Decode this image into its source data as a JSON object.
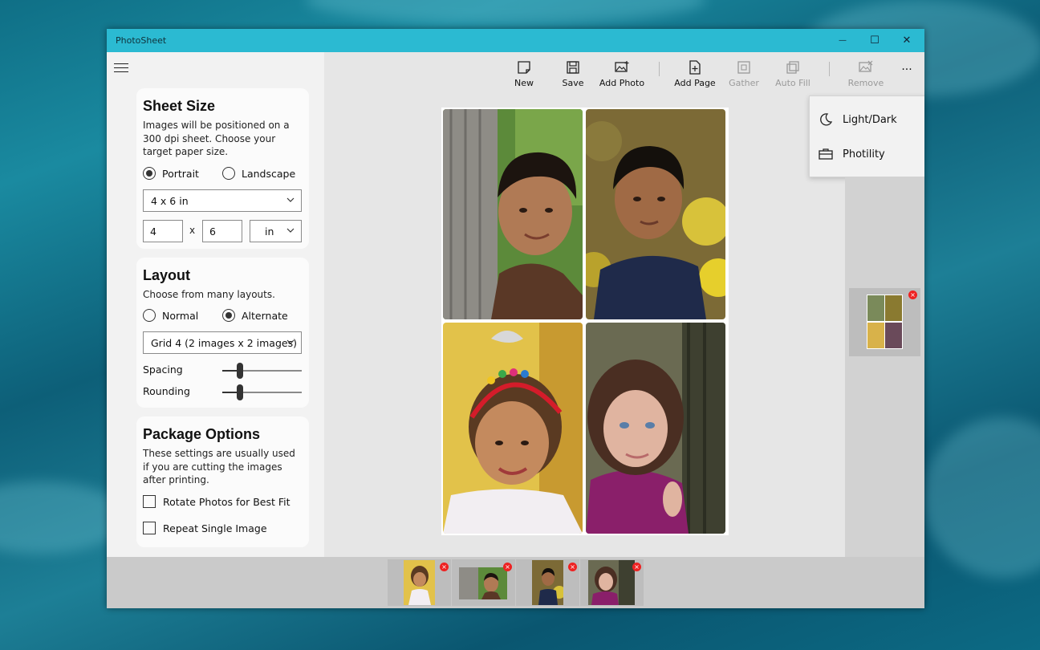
{
  "window": {
    "title": "PhotoSheet",
    "controls": {
      "minimize": "—",
      "maximize": "☐",
      "close": "✕"
    }
  },
  "sheet_size": {
    "title": "Sheet Size",
    "description": "Images will be positioned on a 300 dpi sheet. Choose your target paper size.",
    "orientation_options": [
      "Portrait",
      "Landscape"
    ],
    "orientation_selected": "Portrait",
    "paper_size": "4 x 6 in",
    "width": "4",
    "times": "x",
    "height": "6",
    "unit": "in"
  },
  "layout": {
    "title": "Layout",
    "description": "Choose from many layouts.",
    "mode_options": [
      "Normal",
      "Alternate"
    ],
    "mode_selected": "Alternate",
    "grid": "Grid 4 (2 images x 2 images)",
    "spacing_label": "Spacing",
    "spacing_value": 0.2,
    "rounding_label": "Rounding",
    "rounding_value": 0.2
  },
  "package_options": {
    "title": "Package Options",
    "description": "These settings are usually used if you are cutting the images after printing.",
    "rotate_label": "Rotate Photos for Best Fit",
    "rotate_checked": false,
    "repeat_label": "Repeat Single Image",
    "repeat_checked": false
  },
  "toolbar": {
    "new": "New",
    "save": "Save",
    "add_photo": "Add Photo",
    "add_page": "Add Page",
    "gather": "Gather",
    "auto_fill": "Auto Fill",
    "remove": "Remove",
    "more": "···"
  },
  "more_menu": {
    "items": [
      {
        "label": "Light/Dark",
        "icon": "moon-icon"
      },
      {
        "label": "Photility",
        "icon": "briefcase-icon"
      }
    ]
  },
  "photos": [
    {
      "name": "boy-by-tree",
      "icon": "photo-icon"
    },
    {
      "name": "boy-with-flowers",
      "icon": "photo-icon"
    },
    {
      "name": "girl-with-headband",
      "icon": "photo-icon"
    },
    {
      "name": "girl-by-tree",
      "icon": "photo-icon"
    }
  ],
  "badge_close": "×",
  "colors": {
    "titlebar": "#2bbad2",
    "accent": "#2bbad2",
    "remove_badge": "#e22222"
  }
}
